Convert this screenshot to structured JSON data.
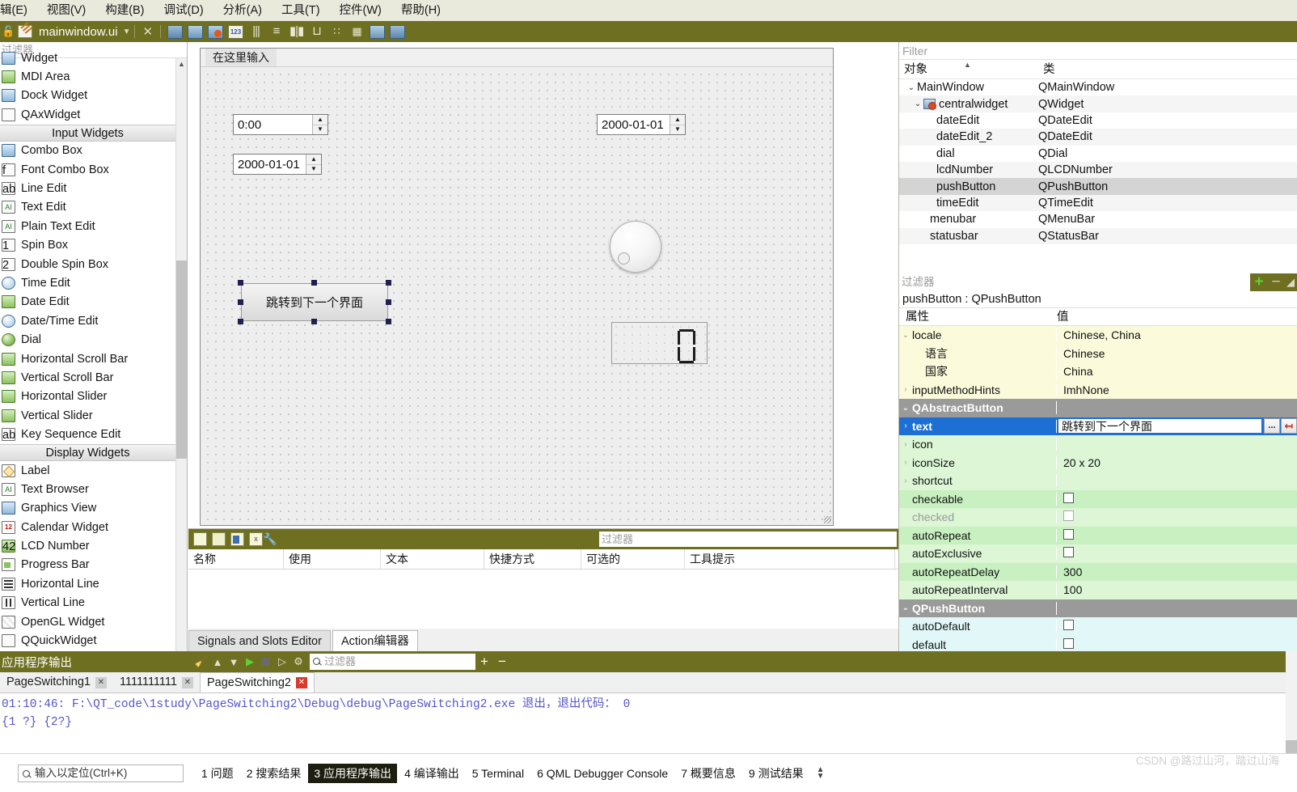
{
  "menubar": {
    "items": [
      "辑(E)",
      "视图(V)",
      "构建(B)",
      "调试(D)",
      "分析(A)",
      "工具(T)",
      "控件(W)",
      "帮助(H)"
    ]
  },
  "doc_toolbar": {
    "title": "mainwindow.ui",
    "icons": [
      "lock-icon",
      "file-icon",
      "chevron-down-icon",
      "close-icon",
      "edit-widgets-icon",
      "edit-signals-icon",
      "edit-buddies-icon",
      "edit-tab-order-icon",
      "layout-horizontal-icon",
      "layout-vertical-icon",
      "layout-splitter-h-icon",
      "layout-splitter-v-icon",
      "layout-form-icon",
      "layout-grid-icon",
      "break-layout-icon",
      "adjust-size-icon"
    ]
  },
  "widget_box": {
    "filter_placeholder": "过滤器",
    "items": [
      {
        "label": "Widget",
        "icon": "widget-icon",
        "type": "item",
        "clipped": true
      },
      {
        "label": "MDI Area",
        "icon": "mdi-area-icon",
        "type": "item"
      },
      {
        "label": "Dock Widget",
        "icon": "dock-widget-icon",
        "type": "item"
      },
      {
        "label": "QAxWidget",
        "icon": "qax-widget-icon",
        "type": "item"
      },
      {
        "label": "Input Widgets",
        "type": "category"
      },
      {
        "label": "Combo Box",
        "icon": "combo-box-icon",
        "type": "item"
      },
      {
        "label": "Font Combo Box",
        "icon": "font-combo-box-icon",
        "type": "item"
      },
      {
        "label": "Line Edit",
        "icon": "line-edit-icon",
        "type": "item"
      },
      {
        "label": "Text Edit",
        "icon": "text-edit-icon",
        "type": "item"
      },
      {
        "label": "Plain Text Edit",
        "icon": "plain-text-edit-icon",
        "type": "item"
      },
      {
        "label": "Spin Box",
        "icon": "spin-box-icon",
        "type": "item"
      },
      {
        "label": "Double Spin Box",
        "icon": "double-spin-box-icon",
        "type": "item"
      },
      {
        "label": "Time Edit",
        "icon": "time-edit-icon",
        "type": "item"
      },
      {
        "label": "Date Edit",
        "icon": "date-edit-icon",
        "type": "item"
      },
      {
        "label": "Date/Time Edit",
        "icon": "date-time-edit-icon",
        "type": "item"
      },
      {
        "label": "Dial",
        "icon": "dial-icon",
        "type": "item"
      },
      {
        "label": "Horizontal Scroll Bar",
        "icon": "h-scrollbar-icon",
        "type": "item"
      },
      {
        "label": "Vertical Scroll Bar",
        "icon": "v-scrollbar-icon",
        "type": "item"
      },
      {
        "label": "Horizontal Slider",
        "icon": "h-slider-icon",
        "type": "item"
      },
      {
        "label": "Vertical Slider",
        "icon": "v-slider-icon",
        "type": "item"
      },
      {
        "label": "Key Sequence Edit",
        "icon": "key-sequence-edit-icon",
        "type": "item"
      },
      {
        "label": "Display Widgets",
        "type": "category"
      },
      {
        "label": "Label",
        "icon": "label-icon",
        "type": "item"
      },
      {
        "label": "Text Browser",
        "icon": "text-browser-icon",
        "type": "item"
      },
      {
        "label": "Graphics View",
        "icon": "graphics-view-icon",
        "type": "item"
      },
      {
        "label": "Calendar Widget",
        "icon": "calendar-widget-icon",
        "type": "item"
      },
      {
        "label": "LCD Number",
        "icon": "lcd-number-icon",
        "type": "item"
      },
      {
        "label": "Progress Bar",
        "icon": "progress-bar-icon",
        "type": "item"
      },
      {
        "label": "Horizontal Line",
        "icon": "h-line-icon",
        "type": "item"
      },
      {
        "label": "Vertical Line",
        "icon": "v-line-icon",
        "type": "item"
      },
      {
        "label": "OpenGL Widget",
        "icon": "opengl-widget-icon",
        "type": "item"
      },
      {
        "label": "QQuickWidget",
        "icon": "qquick-widget-icon",
        "type": "item"
      }
    ]
  },
  "form": {
    "menu_hint": "在这里输入",
    "time_edit": "0:00",
    "date_edit": "2000-01-01",
    "date_edit_2": "2000-01-01",
    "push_button": "跳转到下一个界面"
  },
  "action_editor": {
    "filter_placeholder": "过滤器",
    "columns": [
      "名称",
      "使用",
      "文本",
      "快捷方式",
      "可选的",
      "工具提示"
    ],
    "rows": [],
    "toolbar_icons": [
      "new-action-icon",
      "new-action-2-icon",
      "copy-icon",
      "delete-icon",
      "configure-icon"
    ]
  },
  "editor_tabs": [
    {
      "label": "Signals and Slots Editor",
      "active": false
    },
    {
      "label": "Action编辑器",
      "active": true
    }
  ],
  "object_inspector": {
    "filter_placeholder": "Filter",
    "columns": [
      "对象",
      "类"
    ],
    "rows": [
      {
        "name": "MainWindow",
        "class": "QMainWindow",
        "indent": 1,
        "chevron": "v",
        "icon": null,
        "selected": false
      },
      {
        "name": "centralwidget",
        "class": "QWidget",
        "indent": 2,
        "chevron": "v",
        "icon": "central-widget-icon",
        "selected": false
      },
      {
        "name": "dateEdit",
        "class": "QDateEdit",
        "indent": 4,
        "chevron": "",
        "icon": null,
        "selected": false
      },
      {
        "name": "dateEdit_2",
        "class": "QDateEdit",
        "indent": 4,
        "chevron": "",
        "icon": null,
        "selected": false
      },
      {
        "name": "dial",
        "class": "QDial",
        "indent": 4,
        "chevron": "",
        "icon": null,
        "selected": false
      },
      {
        "name": "lcdNumber",
        "class": "QLCDNumber",
        "indent": 4,
        "chevron": "",
        "icon": null,
        "selected": false
      },
      {
        "name": "pushButton",
        "class": "QPushButton",
        "indent": 4,
        "chevron": "",
        "icon": null,
        "selected": true
      },
      {
        "name": "timeEdit",
        "class": "QTimeEdit",
        "indent": 4,
        "chevron": "",
        "icon": null,
        "selected": false
      },
      {
        "name": "menubar",
        "class": "QMenuBar",
        "indent": 3,
        "chevron": "",
        "icon": null,
        "selected": false
      },
      {
        "name": "statusbar",
        "class": "QStatusBar",
        "indent": 3,
        "chevron": "",
        "icon": null,
        "selected": false
      }
    ]
  },
  "property_editor": {
    "filter_placeholder": "过滤器",
    "object_header": "pushButton : QPushButton",
    "columns": [
      "属性",
      "值"
    ],
    "add_label": "+",
    "remove_label": "−",
    "rows": [
      {
        "name": "locale",
        "value": "Chinese, China",
        "style": "yellow",
        "chevron": "v",
        "indent": 0,
        "kind": "text"
      },
      {
        "name": "语言",
        "value": "Chinese",
        "style": "yellow",
        "chevron": "",
        "indent": 1,
        "kind": "text"
      },
      {
        "name": "国家",
        "value": "China",
        "style": "yellow",
        "chevron": "",
        "indent": 1,
        "kind": "text"
      },
      {
        "name": "inputMethodHints",
        "value": "ImhNone",
        "style": "yellow",
        "chevron": ">",
        "indent": 0,
        "kind": "text"
      },
      {
        "name": "QAbstractButton",
        "value": "",
        "style": "grayhd",
        "chevron": "v",
        "indent": 0,
        "kind": "group"
      },
      {
        "name": "text",
        "value": "跳转到下一个界面",
        "style": "sel",
        "chevron": ">",
        "indent": 0,
        "kind": "editing"
      },
      {
        "name": "icon",
        "value": "",
        "style": "green2",
        "chevron": ">",
        "indent": 0,
        "kind": "text"
      },
      {
        "name": "iconSize",
        "value": "20 x 20",
        "style": "green2",
        "chevron": ">",
        "indent": 0,
        "kind": "text"
      },
      {
        "name": "shortcut",
        "value": "",
        "style": "green2",
        "chevron": ">",
        "indent": 0,
        "kind": "text"
      },
      {
        "name": "checkable",
        "value": "",
        "style": "green",
        "chevron": "",
        "indent": 0,
        "kind": "checkbox"
      },
      {
        "name": "checked",
        "value": "",
        "style": "green2",
        "chevron": "",
        "indent": 0,
        "kind": "checkbox-disabled"
      },
      {
        "name": "autoRepeat",
        "value": "",
        "style": "green",
        "chevron": "",
        "indent": 0,
        "kind": "checkbox"
      },
      {
        "name": "autoExclusive",
        "value": "",
        "style": "green2",
        "chevron": "",
        "indent": 0,
        "kind": "checkbox"
      },
      {
        "name": "autoRepeatDelay",
        "value": "300",
        "style": "green",
        "chevron": "",
        "indent": 0,
        "kind": "text"
      },
      {
        "name": "autoRepeatInterval",
        "value": "100",
        "style": "green2",
        "chevron": "",
        "indent": 0,
        "kind": "text"
      },
      {
        "name": "QPushButton",
        "value": "",
        "style": "grayhd",
        "chevron": "v",
        "indent": 0,
        "kind": "group"
      },
      {
        "name": "autoDefault",
        "value": "",
        "style": "cyan",
        "chevron": "",
        "indent": 0,
        "kind": "checkbox"
      },
      {
        "name": "default",
        "value": "",
        "style": "cyan",
        "chevron": "",
        "indent": 0,
        "kind": "checkbox"
      }
    ],
    "edit_buttons": [
      "...",
      "↤"
    ]
  },
  "output_pane": {
    "title": "应用程序输出",
    "filter_placeholder": "过滤器",
    "plus_label": "+",
    "minus_label": "−",
    "tabs": [
      {
        "label": "PageSwitching1",
        "active": false,
        "close_red": false
      },
      {
        "label": "1111111111",
        "active": false,
        "close_red": false
      },
      {
        "label": "PageSwitching2",
        "active": true,
        "close_red": true
      }
    ],
    "lines": [
      "01:10:46: F:\\QT_code\\1study\\PageSwitching2\\Debug\\debug\\PageSwitching2.exe 退出，退出代码： 0",
      "{1 ?} {2?}"
    ]
  },
  "status_bar": {
    "locator_placeholder": "输入以定位(Ctrl+K)",
    "tabs": [
      {
        "num": "1",
        "label": "问题",
        "active": false
      },
      {
        "num": "2",
        "label": "搜索结果",
        "active": false
      },
      {
        "num": "3",
        "label": "应用程序输出",
        "active": true
      },
      {
        "num": "4",
        "label": "编译输出",
        "active": false
      },
      {
        "num": "5",
        "label": "Terminal",
        "active": false
      },
      {
        "num": "6",
        "label": "QML Debugger Console",
        "active": false
      },
      {
        "num": "7",
        "label": "概要信息",
        "active": false
      },
      {
        "num": "9",
        "label": "测试结果",
        "active": false
      }
    ],
    "watermark": "CSDN @路过山河，踏过山海"
  },
  "colors": {
    "accent": "#6f6f21",
    "selection": "#1d6fd4",
    "property_yellow": "#fbfbdc",
    "property_green": "#c8f0c0",
    "property_cyan": "#e2f8f8"
  }
}
